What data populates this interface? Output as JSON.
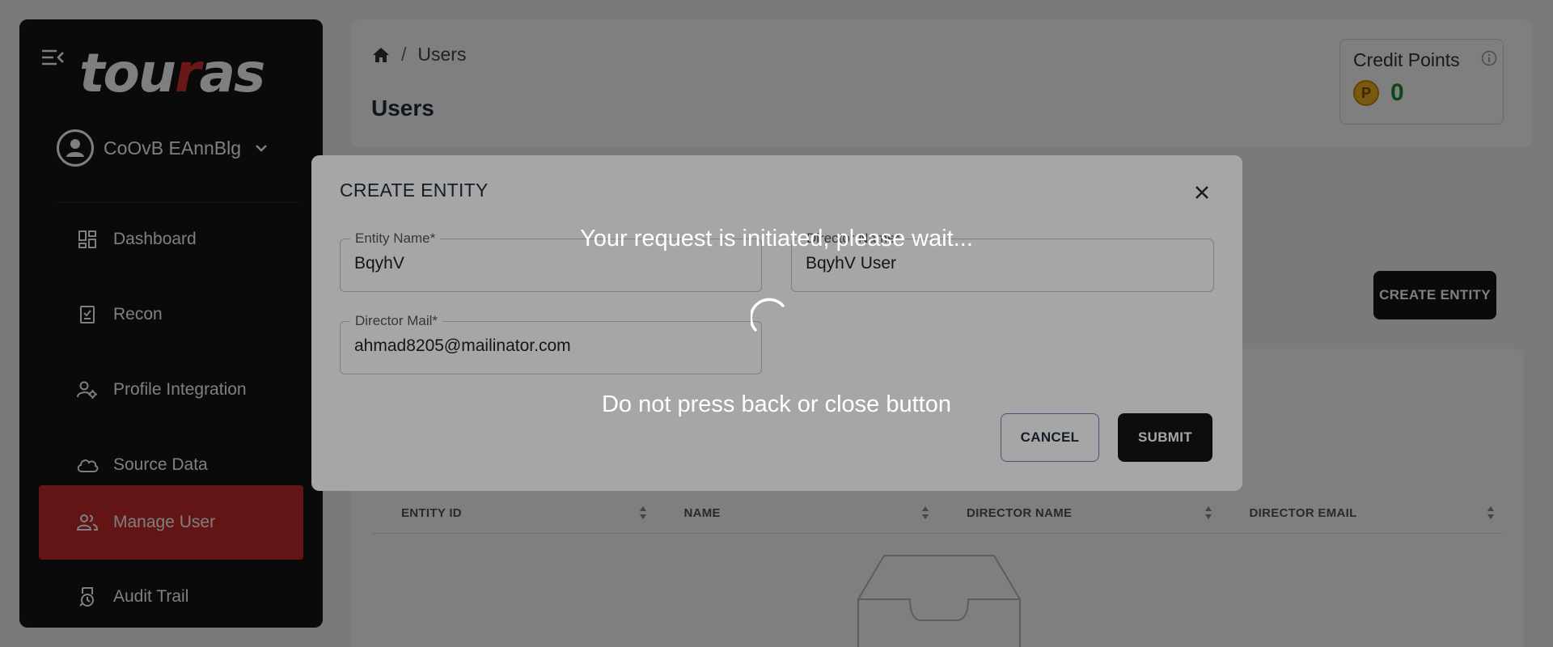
{
  "sidebar": {
    "logo_parts": [
      "tou",
      "r",
      "as"
    ],
    "user_name": "CoOvB EAnnBlg",
    "items": [
      {
        "label": "Dashboard",
        "icon": "dashboard-icon"
      },
      {
        "label": "Recon",
        "icon": "recon-icon"
      },
      {
        "label": "Profile Integration",
        "icon": "profile-settings-icon"
      },
      {
        "label": "Source Data",
        "icon": "cloud-icon"
      },
      {
        "label": "Manage User",
        "icon": "users-icon",
        "active": true
      },
      {
        "label": "Audit Trail",
        "icon": "audit-icon"
      }
    ]
  },
  "header": {
    "breadcrumb": [
      "Users"
    ],
    "title": "Users",
    "credit_label": "Credit Points",
    "credit_value": "0",
    "coin_symbol": "P"
  },
  "main": {
    "create_entity_label": "CREATE ENTITY",
    "table_columns": [
      "ENTITY ID",
      "NAME",
      "DIRECTOR NAME",
      "DIRECTOR EMAIL"
    ]
  },
  "dialog": {
    "title": "CREATE ENTITY",
    "fields": [
      {
        "label": "Entity Name*",
        "value": "BqyhV"
      },
      {
        "label": "Director Name*",
        "value": "BqyhV User"
      },
      {
        "label": "Director Mail*",
        "value": "ahmad8205@mailinator.com"
      }
    ],
    "cancel_label": "CANCEL",
    "submit_label": "SUBMIT"
  },
  "loading": {
    "message": "Your request is initiated, please wait...",
    "warning": "Do not press back or close button"
  },
  "colors": {
    "sidebar_bg": "#141414",
    "active_item": "#c62828",
    "credit_green": "#1b8a3a",
    "primary_button": "#141414"
  }
}
